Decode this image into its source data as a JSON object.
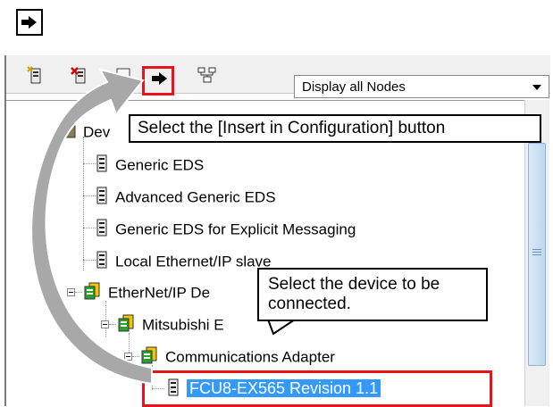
{
  "top_button": {
    "icon": "arrow-right-icon"
  },
  "toolbar": {
    "buttons": [
      {
        "icon": "add-eds-icon"
      },
      {
        "icon": "delete-eds-icon"
      },
      {
        "icon": "properties-icon"
      },
      {
        "icon": "insert-in-configuration-icon"
      },
      {
        "icon": "network-view-icon"
      }
    ],
    "filter": {
      "value": "Display all Nodes"
    }
  },
  "tree": {
    "root_label": "Dev",
    "items": [
      {
        "label": "Generic EDS",
        "icon": "device-icon"
      },
      {
        "label": "Advanced Generic EDS",
        "icon": "device-icon"
      },
      {
        "label": "Generic EDS for Explicit Messaging",
        "icon": "device-icon"
      },
      {
        "label": "Local Ethernet/IP slave",
        "icon": "device-icon"
      },
      {
        "label": "EtherNet/IP De",
        "icon": "device-group-icon"
      },
      {
        "label": "Mitsubishi E",
        "icon": "device-group-icon"
      },
      {
        "label": "Communications Adapter",
        "icon": "device-group-icon"
      },
      {
        "label": "FCU8-EX565 Revision 1.1",
        "icon": "device-icon",
        "selected": true
      }
    ]
  },
  "callouts": {
    "insert": "Select the [Insert in Configuration] button",
    "device_line1": "Select the device to be",
    "device_line2": "connected."
  },
  "colors": {
    "highlight_red": "#e8141c",
    "selection_blue": "#3399ff",
    "arrow_gray": "#a8a8a8"
  }
}
